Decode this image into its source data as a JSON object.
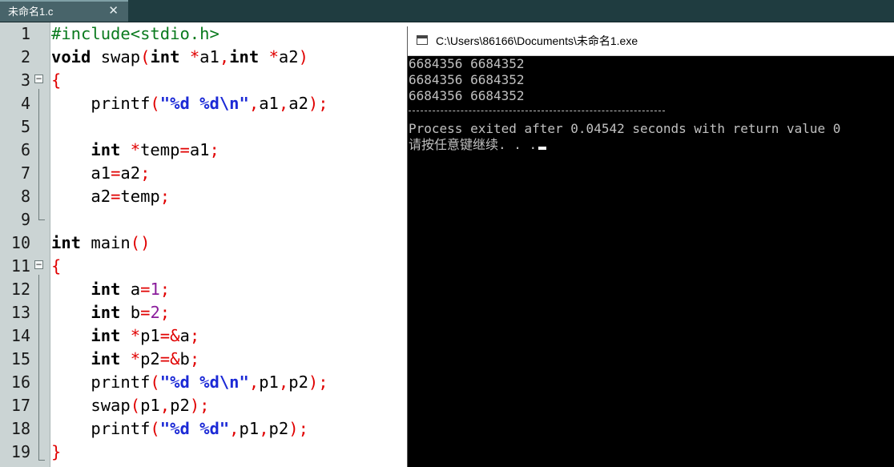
{
  "tab": {
    "title": "未命名1.c",
    "close_glyph": "✕"
  },
  "gutter": {
    "line_numbers": [
      "1",
      "2",
      "3",
      "4",
      "5",
      "6",
      "7",
      "8",
      "9",
      "10",
      "11",
      "12",
      "13",
      "14",
      "15",
      "16",
      "17",
      "18",
      "19"
    ],
    "fold_glyph": "−"
  },
  "code": {
    "l1": {
      "a": "#include<stdio.h>"
    },
    "l2": {
      "a": "void",
      "b": " swap",
      "c": "(",
      "d": "int",
      "e": " ",
      "f": "*",
      "g": "a1",
      "h": ",",
      "i": "int",
      "j": " ",
      "k": "*",
      "m": "a2",
      "n": ")"
    },
    "l3": {
      "a": "{"
    },
    "l4": {
      "a": "    printf",
      "b": "(",
      "c": "\"%d %d\\n\"",
      "d": ",",
      "e": "a1",
      "f": ",",
      "g": "a2",
      "h": ");"
    },
    "l6": {
      "a": "    ",
      "b": "int",
      "c": " ",
      "d": "*",
      "e": "temp",
      "f": "=",
      "g": "a1",
      "h": ";"
    },
    "l7": {
      "a": "    a1",
      "b": "=",
      "c": "a2",
      "d": ";"
    },
    "l8": {
      "a": "    a2",
      "b": "=",
      "c": "temp",
      "d": ";"
    },
    "l10": {
      "a": "int",
      "b": " main",
      "c": "()"
    },
    "l11": {
      "a": "{"
    },
    "l12": {
      "a": "    ",
      "b": "int",
      "c": " a",
      "d": "=",
      "e": "1",
      "f": ";"
    },
    "l13": {
      "a": "    ",
      "b": "int",
      "c": " b",
      "d": "=",
      "e": "2",
      "f": ";"
    },
    "l14": {
      "a": "    ",
      "b": "int",
      "c": " ",
      "d": "*",
      "e": "p1",
      "f": "=&",
      "g": "a",
      "h": ";"
    },
    "l15": {
      "a": "    ",
      "b": "int",
      "c": " ",
      "d": "*",
      "e": "p2",
      "f": "=&",
      "g": "b",
      "h": ";"
    },
    "l16": {
      "a": "    printf",
      "b": "(",
      "c": "\"%d %d\\n\"",
      "d": ",",
      "e": "p1",
      "f": ",",
      "g": "p2",
      "h": ");"
    },
    "l17": {
      "a": "    swap",
      "b": "(",
      "c": "p1",
      "d": ",",
      "e": "p2",
      "f": ");"
    },
    "l18": {
      "a": "    printf",
      "b": "(",
      "c": "\"%d %d\"",
      "d": ",",
      "e": "p1",
      "f": ",",
      "g": "p2",
      "h": ");"
    },
    "l19": {
      "a": "}"
    }
  },
  "console": {
    "title": "C:\\Users\\86166\\Documents\\未命名1.exe",
    "lines": [
      "6684356 6684352",
      "6684356 6684352",
      "6684356 6684352",
      "Process exited after 0.04542 seconds with return value 0",
      "请按任意键继续. . ."
    ]
  },
  "colors": {
    "keyword": "#000000",
    "preprocessor": "#0a7a1e",
    "operator": "#e00000",
    "string": "#1b29d6",
    "number": "#8a1c9c",
    "current_line": "#c8f6f4",
    "gutter": "#cbd4d4",
    "tabbar": "#1f3c40",
    "console_bg": "#000000",
    "console_text": "#c0c0c0"
  }
}
